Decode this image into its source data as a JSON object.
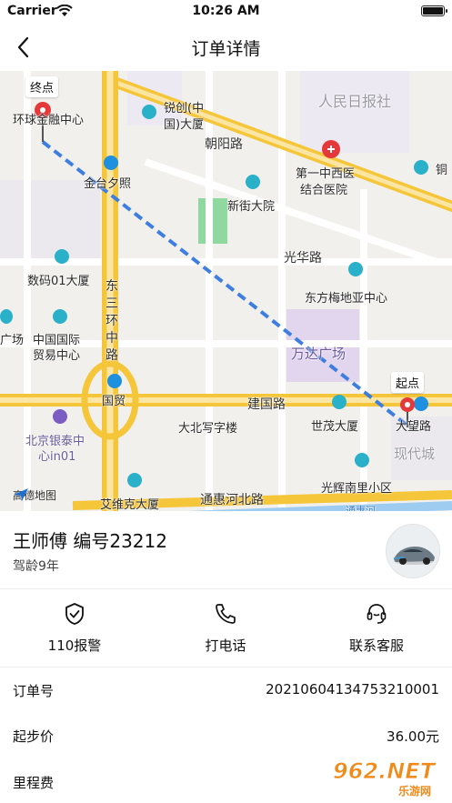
{
  "status_bar": {
    "carrier": "Carrier",
    "time": "10:26 AM"
  },
  "nav": {
    "title": "订单详情"
  },
  "map": {
    "end_label": "终点",
    "start_label": "起点",
    "provider": "高德地图",
    "places": [
      "环球金融中心",
      "锐创(中",
      "国)大厦",
      "人民日报社",
      "朝阳路",
      "第一中西医",
      "结合医院",
      "铜",
      "金台夕照",
      "新街大院",
      "光华路",
      "数码01大厦",
      "东方梅地亚中心",
      "广场",
      "中国国际",
      "贸易中心",
      "万达广场",
      "东",
      "三",
      "环",
      "中",
      "路",
      "国贸",
      "建国路",
      "大北写字楼",
      "世茂大厦",
      "大望路",
      "北京银泰中",
      "心in01",
      "现代城",
      "光辉南里小区",
      "艾维克大厦",
      "通惠河北路",
      "通惠河"
    ],
    "colors": {
      "road_major": "#f5c53a",
      "road_minor": "#ffffff",
      "route": "#3d7ee0",
      "pin": "#e5383b",
      "poi": "#2bb0c9"
    }
  },
  "driver": {
    "name": "王师傅  编号23212",
    "years": "驾龄9年"
  },
  "actions": [
    {
      "label": "110报警",
      "icon": "shield-check-icon"
    },
    {
      "label": "打电话",
      "icon": "phone-icon"
    },
    {
      "label": "联系客服",
      "icon": "headset-icon"
    }
  ],
  "order": [
    {
      "key": "订单号",
      "value": "20210604134753210001"
    },
    {
      "key": "起步价",
      "value": "36.00元"
    },
    {
      "key": "里程费",
      "value": ""
    }
  ],
  "watermark": {
    "brand": "962.NET",
    "sub": "乐游网"
  }
}
